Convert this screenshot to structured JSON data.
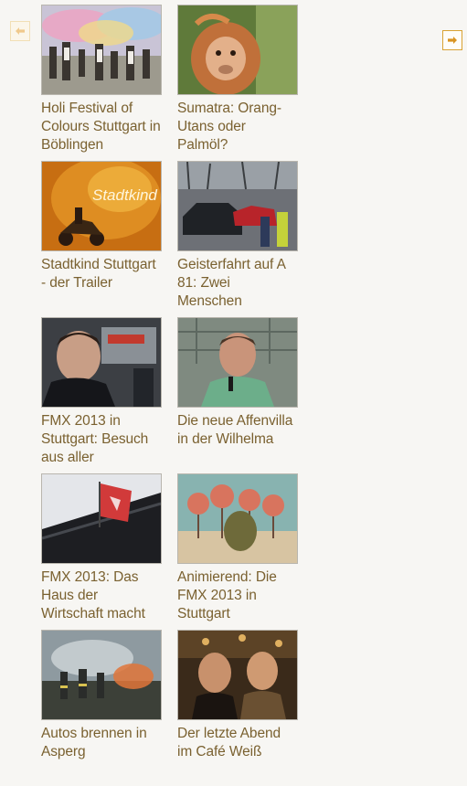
{
  "nav": {
    "prev_icon": "arrow-left-icon",
    "next_icon": "arrow-right-icon",
    "accent": "#d9a233"
  },
  "videos": [
    {
      "title": "Holi Festival of Colours Stuttgart in Böblingen",
      "thumb": "holi-festival-thumbnail"
    },
    {
      "title": "Sumatra: Orang-Utans oder Palmöl?",
      "thumb": "orangutan-thumbnail"
    },
    {
      "title": "Stadtkind Stuttgart - der Trailer",
      "thumb": "stadtkind-thumbnail",
      "thumb_text": "Stadtkind"
    },
    {
      "title": "Geisterfahrt auf A 81: Zwei Menschen",
      "thumb": "accident-thumbnail"
    },
    {
      "title": "FMX 2013 in Stuttgart: Besuch aus aller",
      "thumb": "fmx-visitor-thumbnail"
    },
    {
      "title": "Die neue Affenvilla in der Wilhelma",
      "thumb": "affenvilla-thumbnail"
    },
    {
      "title": "FMX 2013: Das Haus der Wirtschaft macht",
      "thumb": "haus-der-wirtschaft-thumbnail"
    },
    {
      "title": "Animierend: Die FMX 2013 in Stuttgart",
      "thumb": "animation-thumbnail"
    },
    {
      "title": "Autos brennen in Asperg",
      "thumb": "burning-cars-thumbnail"
    },
    {
      "title": "Der letzte Abend im Café Weiß",
      "thumb": "cafe-weiss-thumbnail"
    }
  ]
}
